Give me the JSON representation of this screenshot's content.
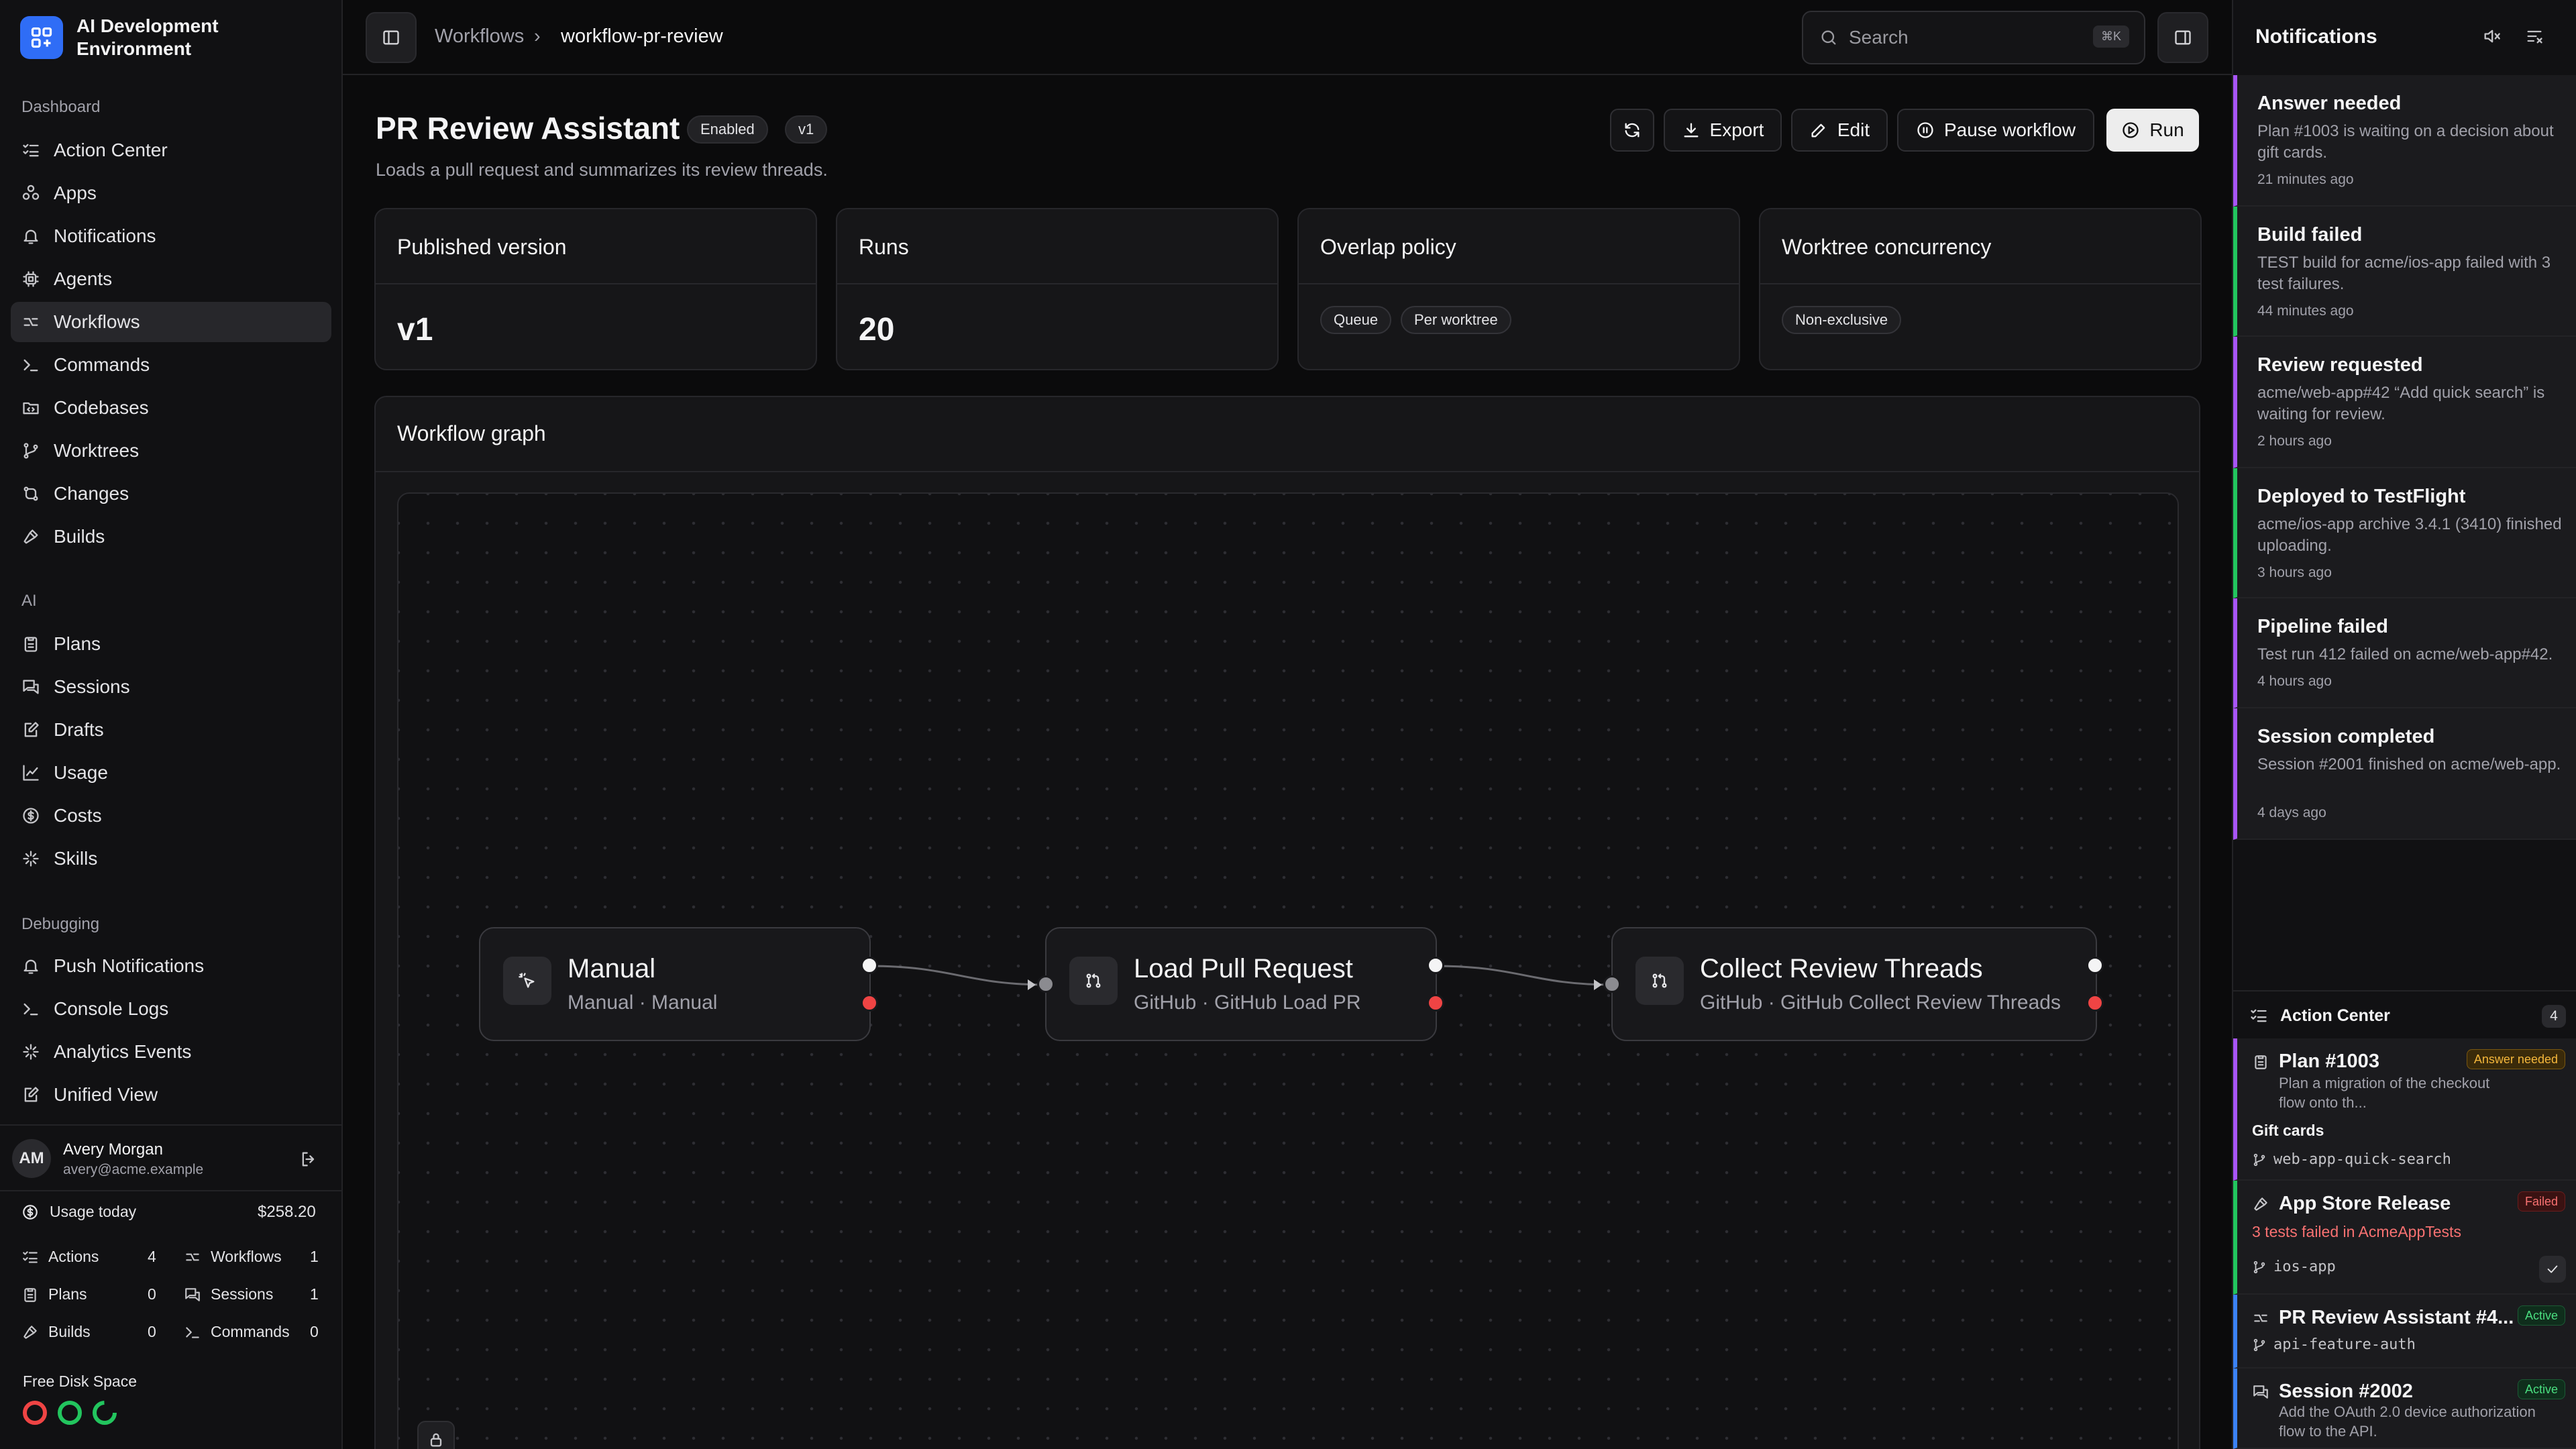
{
  "app": {
    "name": "AI Development Environment"
  },
  "sidebar": {
    "sections": [
      "Dashboard",
      "AI",
      "Debugging"
    ],
    "dashboard_items": [
      {
        "label": "Action Center",
        "icon": "list-checks-icon"
      },
      {
        "label": "Apps",
        "icon": "apps-icon"
      },
      {
        "label": "Notifications",
        "icon": "bell-icon"
      },
      {
        "label": "Agents",
        "icon": "chip-icon"
      },
      {
        "label": "Workflows",
        "icon": "workflow-icon"
      },
      {
        "label": "Commands",
        "icon": "terminal-icon"
      },
      {
        "label": "Codebases",
        "icon": "folder-code-icon"
      },
      {
        "label": "Worktrees",
        "icon": "git-branch-icon"
      },
      {
        "label": "Changes",
        "icon": "git-compare-icon"
      },
      {
        "label": "Builds",
        "icon": "hammer-icon"
      }
    ],
    "ai_items": [
      {
        "label": "Plans",
        "icon": "clipboard-icon"
      },
      {
        "label": "Sessions",
        "icon": "chat-icon"
      },
      {
        "label": "Drafts",
        "icon": "draft-icon"
      },
      {
        "label": "Usage",
        "icon": "chart-icon"
      },
      {
        "label": "Costs",
        "icon": "dollar-icon"
      },
      {
        "label": "Skills",
        "icon": "sparkle-icon"
      }
    ],
    "debug_items": [
      {
        "label": "Push Notifications",
        "icon": "bell-icon"
      },
      {
        "label": "Console Logs",
        "icon": "terminal-icon"
      },
      {
        "label": "Analytics Events",
        "icon": "sparkle-icon"
      },
      {
        "label": "Unified View",
        "icon": "draft-icon"
      }
    ],
    "active": "Workflows"
  },
  "user": {
    "initials": "AM",
    "name": "Avery Morgan",
    "email": "avery@acme.example"
  },
  "usage": {
    "label": "Usage today",
    "amount": "$258.20",
    "stats": [
      {
        "label": "Actions",
        "value": "4"
      },
      {
        "label": "Workflows",
        "value": "1"
      },
      {
        "label": "Plans",
        "value": "0"
      },
      {
        "label": "Sessions",
        "value": "1"
      },
      {
        "label": "Builds",
        "value": "0"
      },
      {
        "label": "Commands",
        "value": "0"
      }
    ],
    "disk_label": "Free Disk Space",
    "disk_colors": [
      "#ef4444",
      "#22c55e",
      "#22c55e"
    ]
  },
  "topbar": {
    "breadcrumb_root": "Workflows",
    "breadcrumb_sep": "›",
    "breadcrumb_current": "workflow-pr-review",
    "search_placeholder": "Search",
    "search_shortcut": "⌘K"
  },
  "page": {
    "title": "PR Review Assistant",
    "status": "Enabled",
    "version": "v1",
    "description": "Loads a pull request and summarizes its review threads.",
    "actions": {
      "export": "Export",
      "edit": "Edit",
      "pause": "Pause workflow",
      "run": "Run"
    }
  },
  "cards": {
    "published": {
      "title": "Published version",
      "value": "v1"
    },
    "runs": {
      "title": "Runs",
      "value": "20"
    },
    "overlap": {
      "title": "Overlap policy",
      "tags": [
        "Queue",
        "Per worktree"
      ]
    },
    "concurrency": {
      "title": "Worktree concurrency",
      "tags": [
        "Non-exclusive"
      ]
    }
  },
  "graph": {
    "title": "Workflow graph",
    "nodes": [
      {
        "title": "Manual",
        "subtitle": "Manual · Manual",
        "icon": "pointer-click-icon"
      },
      {
        "title": "Load Pull Request",
        "subtitle": "GitHub · GitHub Load PR",
        "icon": "git-pull-request-icon"
      },
      {
        "title": "Collect Review Threads",
        "subtitle": "GitHub · GitHub Collect Review Threads",
        "icon": "git-pull-request-icon"
      }
    ]
  },
  "notifications": {
    "title": "Notifications",
    "items": [
      {
        "title": "Answer needed",
        "body": "Plan #1003 is waiting on a decision about gift cards.",
        "time": "21 minutes ago",
        "color": "#a855f7"
      },
      {
        "title": "Build failed",
        "body": "TEST build for acme/ios-app failed with 3 test failures.",
        "time": "44 minutes ago",
        "color": "#22c55e"
      },
      {
        "title": "Review requested",
        "body": "acme/web-app#42 “Add quick search” is waiting for review.",
        "time": "2 hours ago",
        "color": "#a855f7"
      },
      {
        "title": "Deployed to TestFlight",
        "body": "acme/ios-app archive 3.4.1 (3410) finished uploading.",
        "time": "3 hours ago",
        "color": "#22c55e"
      },
      {
        "title": "Pipeline failed",
        "body": "Test run 412 failed on acme/web-app#42.",
        "time": "4 hours ago",
        "color": "#a855f7"
      },
      {
        "title": "Session completed",
        "body": "Session #2001 finished on acme/web-app.",
        "time": "4 days ago",
        "color": "#a855f7"
      }
    ]
  },
  "action_center": {
    "title": "Action Center",
    "count": "4",
    "items": [
      {
        "title": "Plan #1003",
        "badge": "Answer needed",
        "subtitle": "Plan a migration of the checkout flow onto th...",
        "extra": "Gift cards",
        "branch": "web-app-quick-search"
      },
      {
        "title": "App Store Release",
        "badge": "Failed",
        "subtitle": "3 tests failed in AcmeAppTests",
        "branch": "ios-app"
      },
      {
        "title": "PR Review Assistant #4...",
        "badge": "Active",
        "branch": "api-feature-auth"
      },
      {
        "title": "Session #2002",
        "badge": "Active",
        "subtitle": "Add the OAuth 2.0 device authorization flow to the API."
      }
    ]
  }
}
